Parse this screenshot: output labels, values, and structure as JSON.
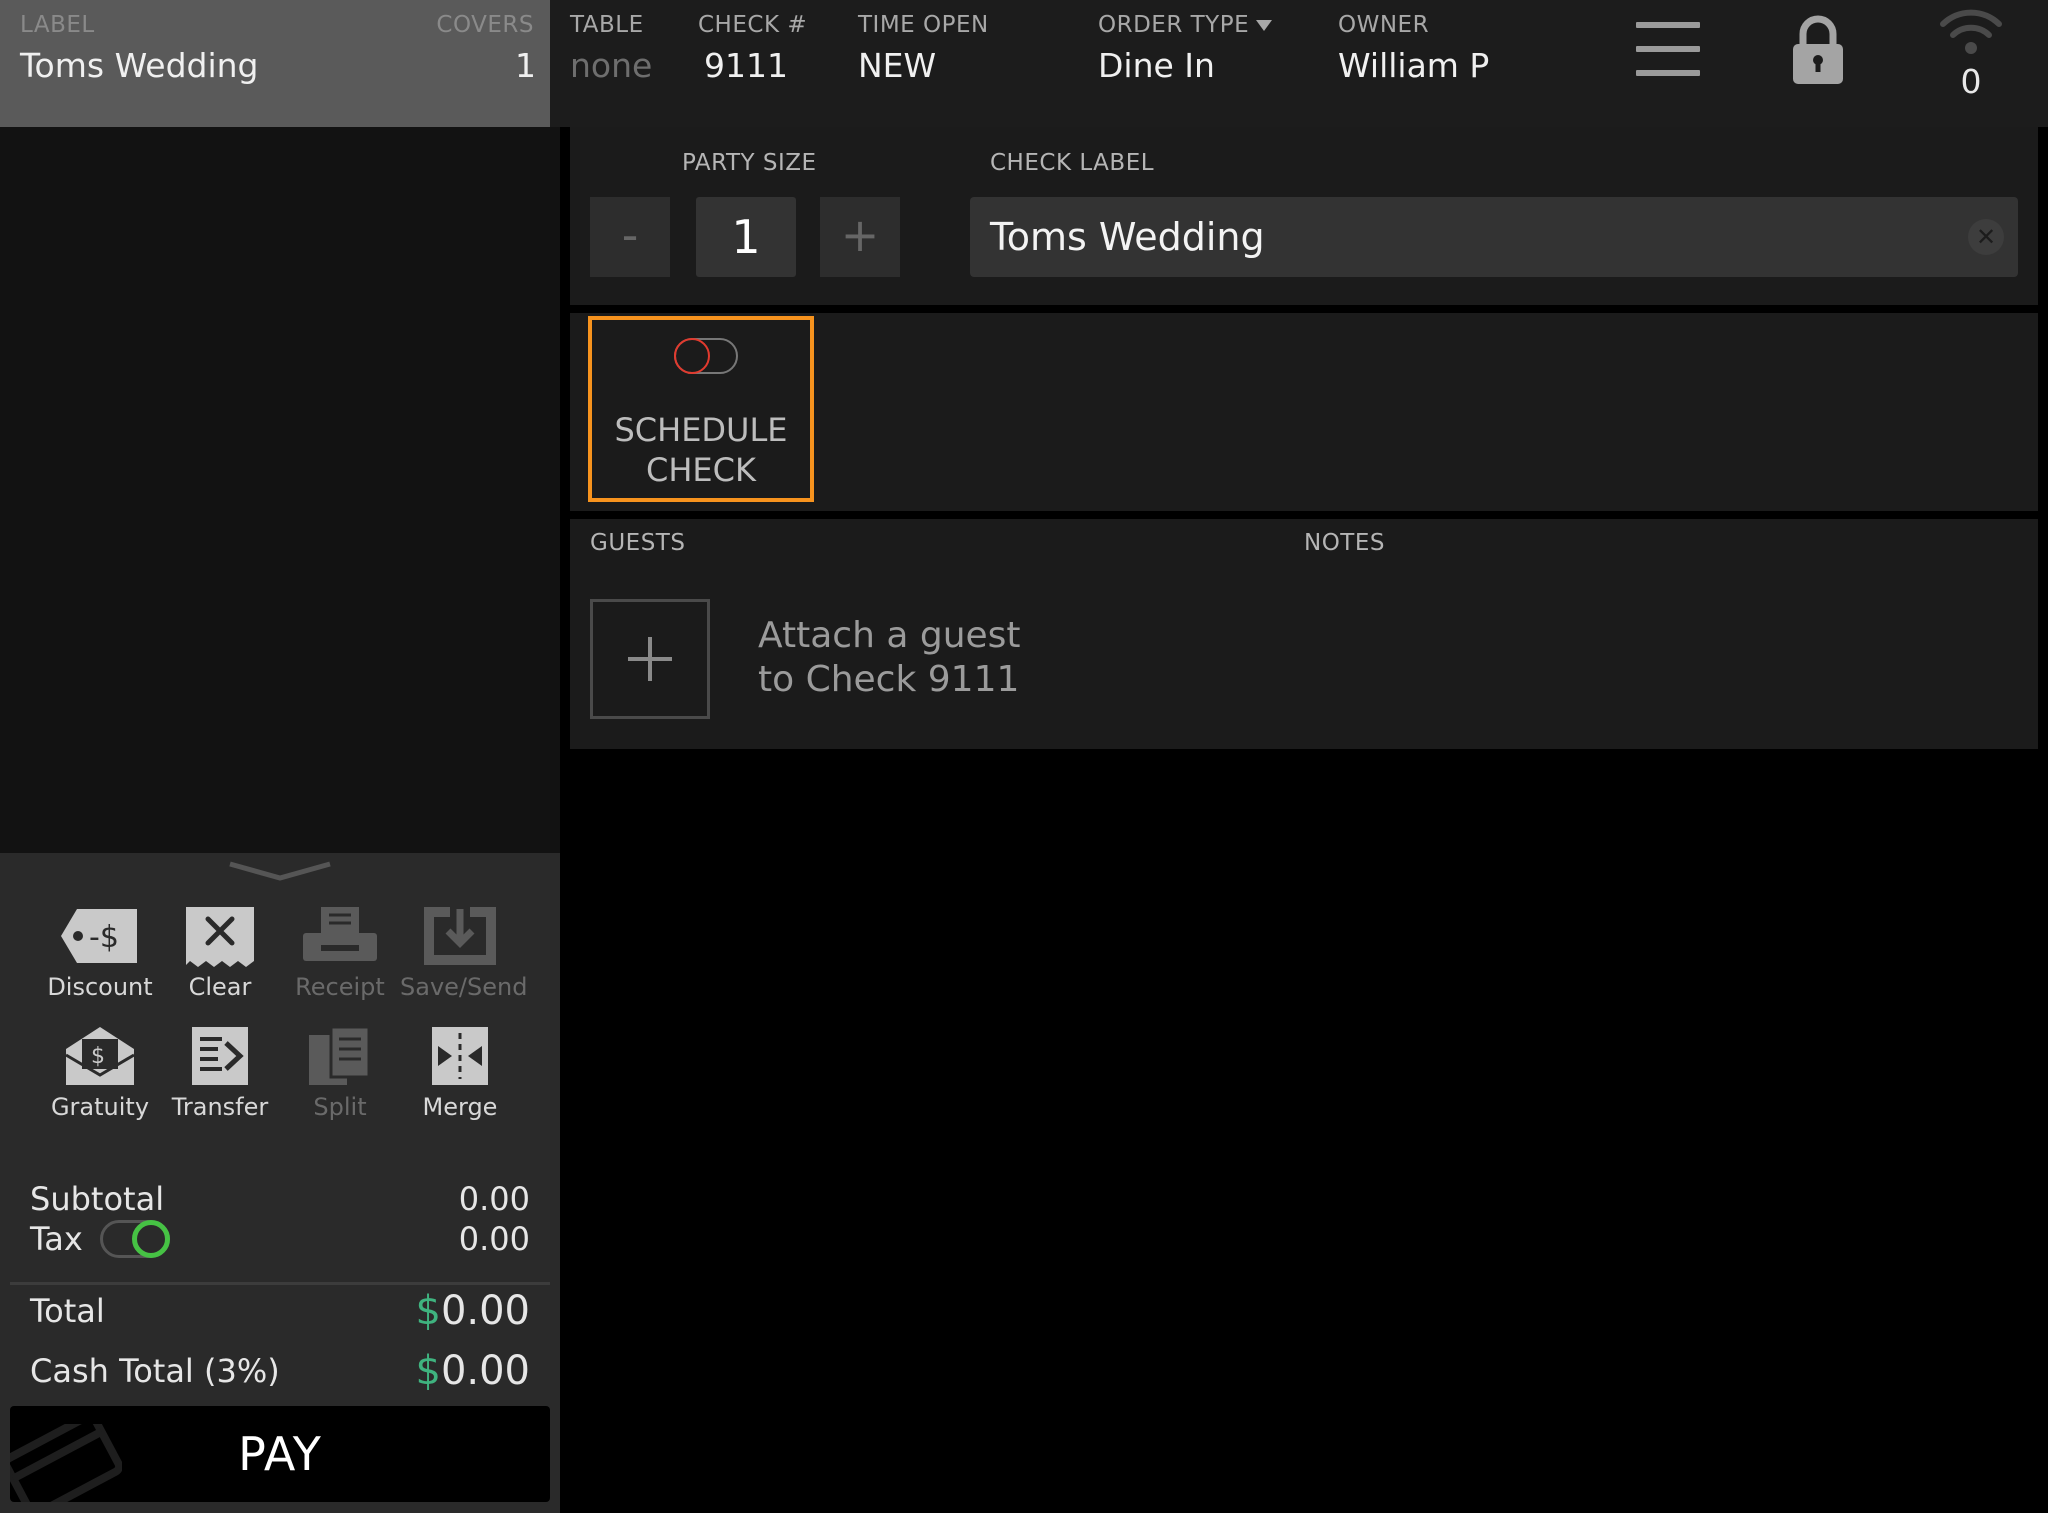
{
  "header": {
    "label_caption": "LABEL",
    "label_value": "Toms Wedding",
    "covers_caption": "COVERS",
    "covers_value": "1",
    "table_caption": "TABLE",
    "table_value": "none",
    "check_caption": "CHECK #",
    "check_value": "9111",
    "time_caption": "TIME OPEN",
    "time_value": "NEW",
    "order_type_caption": "ORDER TYPE",
    "order_type_value": "Dine In",
    "owner_caption": "OWNER",
    "owner_value": "William P",
    "wifi_count": "0",
    "icons": [
      "menu-icon",
      "lock-icon",
      "wifi-icon",
      "dropdown-caret-icon"
    ]
  },
  "check_details": {
    "party_size_caption": "PARTY SIZE",
    "party_size_value": "1",
    "minus_label": "-",
    "plus_label": "+",
    "check_label_caption": "CHECK LABEL",
    "check_label_value": "Toms Wedding",
    "clear_symbol": "✕"
  },
  "schedule": {
    "label_line1": "SCHEDULE",
    "label_line2": "CHECK",
    "enabled": false
  },
  "guests": {
    "guests_caption": "GUESTS",
    "notes_caption": "NOTES",
    "attach_line1": "Attach a guest",
    "attach_line2": "to Check 9111"
  },
  "actions": [
    {
      "label": "Discount",
      "icon": "discount-tag-icon",
      "enabled": true
    },
    {
      "label": "Clear",
      "icon": "clear-receipt-icon",
      "enabled": true
    },
    {
      "label": "Receipt",
      "icon": "printer-icon",
      "enabled": false
    },
    {
      "label": "Save/Send",
      "icon": "save-send-icon",
      "enabled": false
    },
    {
      "label": "Gratuity",
      "icon": "gratuity-envelope-icon",
      "enabled": true
    },
    {
      "label": "Transfer",
      "icon": "transfer-icon",
      "enabled": true
    },
    {
      "label": "Split",
      "icon": "split-icon",
      "enabled": false
    },
    {
      "label": "Merge",
      "icon": "merge-icon",
      "enabled": true
    }
  ],
  "totals": {
    "subtotal_label": "Subtotal",
    "subtotal_value": "0.00",
    "tax_label": "Tax",
    "tax_value": "0.00",
    "tax_enabled": true,
    "total_label": "Total",
    "total_currency": "$",
    "total_value": "0.00",
    "cash_total_label": "Cash Total (3%)",
    "cash_currency": "$",
    "cash_total_value": "0.00"
  },
  "pay_label": "PAY",
  "colors": {
    "accent_orange": "#f7931e",
    "money_green": "#3fb37f",
    "toggle_on_green": "#46c244",
    "toggle_off_red": "#e23a2e"
  }
}
